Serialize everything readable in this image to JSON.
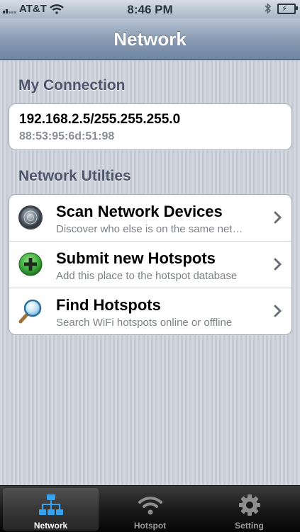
{
  "status_bar": {
    "carrier": "AT&T",
    "time": "8:46 PM"
  },
  "nav": {
    "title": "Network"
  },
  "my_connection": {
    "header": "My Connection",
    "ip_mask": "192.168.2.5/255.255.255.0",
    "mac": "88:53:95:6d:51:98"
  },
  "utilities": {
    "header": "Network Utilties",
    "items": [
      {
        "title": "Scan Network Devices",
        "subtitle": "Discover who else is on the same net…",
        "icon": "radar-icon"
      },
      {
        "title": "Submit new Hotspots",
        "subtitle": "Add this place to the hotspot database",
        "icon": "add-icon"
      },
      {
        "title": "Find Hotspots",
        "subtitle": "Search WiFi hotspots online or offline",
        "icon": "magnifier-icon"
      }
    ]
  },
  "tabs": [
    {
      "label": "Network",
      "icon": "network-icon",
      "active": true
    },
    {
      "label": "Hotspot",
      "icon": "wifi-icon",
      "active": false
    },
    {
      "label": "Setting",
      "icon": "gear-icon",
      "active": false
    }
  ],
  "colors": {
    "accent_green": "#3fae3f",
    "nav_blue": "#6f85a1"
  }
}
